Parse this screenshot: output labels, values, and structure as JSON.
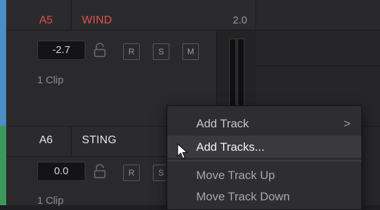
{
  "tracks": [
    {
      "id": "A5",
      "name": "WIND",
      "format": "2.0",
      "volume": "-2.7",
      "buttons": [
        "R",
        "S",
        "M"
      ],
      "clips": "1 Clip",
      "color": "#4a8fc7",
      "label_color": "#e0524a"
    },
    {
      "id": "A6",
      "name": "STING",
      "volume": "0.0",
      "buttons": [
        "R",
        "S"
      ],
      "clips": "1 Clip",
      "color": "#3a9a5c"
    }
  ],
  "context_menu": {
    "items": [
      {
        "label": "Add Track",
        "submenu": ">"
      },
      {
        "label": "Add Tracks...",
        "highlighted": true
      },
      {
        "label": "Move Track Up"
      },
      {
        "label": "Move Track Down"
      }
    ]
  },
  "icons": [
    "lock-icon",
    "mouse-cursor-icon",
    "chevron-right-icon"
  ]
}
